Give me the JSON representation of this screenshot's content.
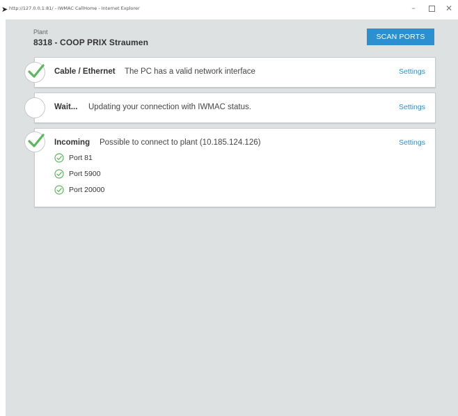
{
  "window": {
    "title": "http://127.0.0.1:81/ - IWMAC CallHome - Internet Explorer",
    "app_icon": "ie-cursor-icon",
    "controls": [
      "minimize",
      "maximize",
      "close"
    ]
  },
  "plant": {
    "label": "Plant",
    "name": "8318 - COOP PRIX Straumen"
  },
  "toolbar": {
    "scan_label": "SCAN PORTS"
  },
  "cards": [
    {
      "title": "Cable / Ethernet",
      "description": "The PC has a valid network interface",
      "settings_label": "Settings",
      "status": "ok"
    },
    {
      "title": "Wait...",
      "description": "Updating your connection with IWMAC status.",
      "settings_label": "Settings",
      "status": "pending"
    },
    {
      "title": "Incoming",
      "description": "Possible to connect to plant (10.185.124.126)",
      "settings_label": "Settings",
      "status": "ok",
      "ports": [
        {
          "label": "Port 81",
          "status": "ok"
        },
        {
          "label": "Port 5900",
          "status": "ok"
        },
        {
          "label": "Port 20000",
          "status": "ok"
        }
      ]
    }
  ],
  "colors": {
    "accent": "#2b8fd0",
    "success": "#5cb85c",
    "background": "#dde1e2"
  }
}
